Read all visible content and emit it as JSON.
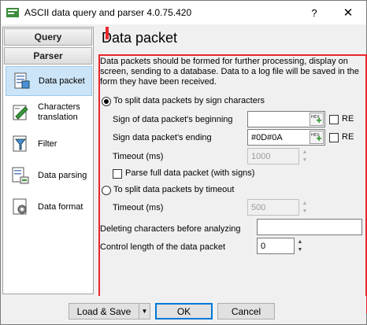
{
  "window": {
    "title": "ASCII data query and parser 4.0.75.420",
    "help_label": "?",
    "close_label": "✕"
  },
  "sidebar": {
    "headers": [
      "Query",
      "Parser"
    ],
    "items": [
      {
        "label": "Data packet",
        "icon": "data-packet-icon"
      },
      {
        "label": "Characters translation",
        "icon": "characters-translation-icon"
      },
      {
        "label": "Filter",
        "icon": "filter-icon"
      },
      {
        "label": "Data parsing",
        "icon": "data-parsing-icon"
      },
      {
        "label": "Data format",
        "icon": "data-format-icon"
      }
    ]
  },
  "main": {
    "title": "Data packet",
    "description": "Data packets should be formed for further processing, display on screen, sending to a database. Data to a log file will be saved in the form they have been received.",
    "mode_sign": {
      "label": "To split data packets by sign characters",
      "selected": true,
      "beginning_label": "Sign of data packet's beginning",
      "beginning_value": "",
      "ending_label": "Sign data packet's ending",
      "ending_value": "#0D#0A",
      "re_label": "RE",
      "timeout_label": "Timeout (ms)",
      "timeout_value": "1000",
      "parse_full_label": "Parse full data packet (with signs)"
    },
    "mode_timeout": {
      "label": "To split data packets by timeout",
      "selected": false,
      "timeout_label": "Timeout (ms)",
      "timeout_value": "500"
    },
    "deleting_label": "Deleting characters before analyzing",
    "deleting_value": "",
    "control_length_label": "Control length of the data packet",
    "control_length_value": "0",
    "hex_button_text": "HEX"
  },
  "footer": {
    "load_save_label": "Load & Save",
    "ok_label": "OK",
    "cancel_label": "Cancel"
  },
  "colors": {
    "highlight_frame": "#e8262c",
    "selected_item": "#cce4f7",
    "default_button_border": "#0078d7"
  }
}
